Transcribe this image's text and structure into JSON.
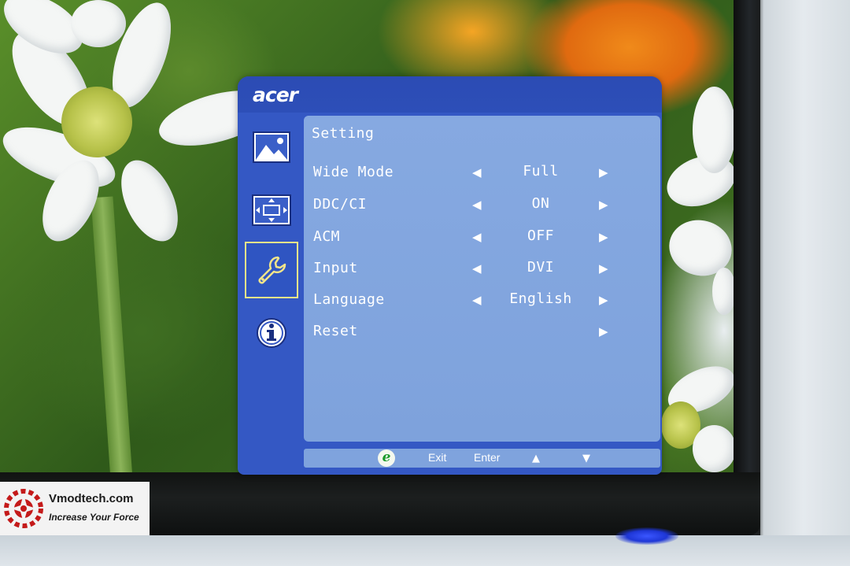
{
  "osd": {
    "brand": "acer",
    "panel_title": "Setting",
    "tabs": [
      {
        "icon": "picture-icon",
        "active": false
      },
      {
        "icon": "position-icon",
        "active": false
      },
      {
        "icon": "wrench-icon",
        "active": true
      },
      {
        "icon": "info-icon",
        "active": false
      }
    ],
    "rows": [
      {
        "label": "Wide Mode",
        "value": "Full",
        "left_arrow": "◀",
        "right_arrow": "▶"
      },
      {
        "label": "DDC/CI",
        "value": "ON",
        "left_arrow": "◀",
        "right_arrow": "▶"
      },
      {
        "label": "ACM",
        "value": "OFF",
        "left_arrow": "◀",
        "right_arrow": "▶"
      },
      {
        "label": "Input",
        "value": "DVI",
        "left_arrow": "◀",
        "right_arrow": "▶"
      },
      {
        "label": "Language",
        "value": "English",
        "left_arrow": "◀",
        "right_arrow": "▶"
      },
      {
        "label": "Reset",
        "value": "",
        "left_arrow": "",
        "right_arrow": "▶"
      }
    ],
    "footer": {
      "e_key": "e",
      "exit": "Exit",
      "enter": "Enter",
      "up": "▲",
      "down": "▼"
    },
    "colors": {
      "frame": "#3458c4",
      "panel": "#7fa3dd",
      "active_tab_border": "#f1e48a"
    }
  },
  "watermark": {
    "name": "Vmodtech.com",
    "tagline": "Increase Your Force"
  }
}
